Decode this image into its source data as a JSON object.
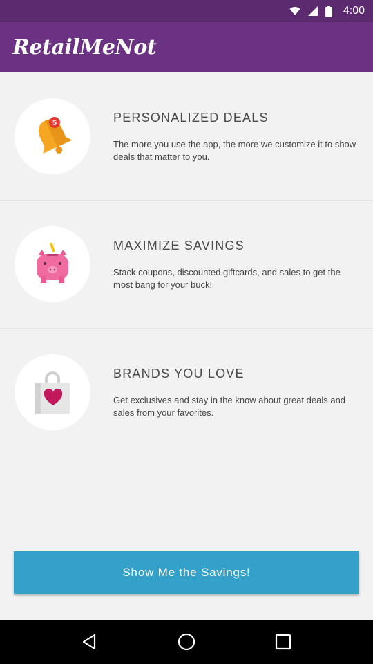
{
  "status_bar": {
    "time": "4:00",
    "icons": [
      "wifi-icon",
      "signal-icon",
      "battery-icon"
    ]
  },
  "app_bar": {
    "logo_text": "RetailMeNot"
  },
  "features": [
    {
      "icon": "bell-icon",
      "badge": "5",
      "title": "PERSONALIZED DEALS",
      "description": "The more you use the app, the more we customize it to show deals that matter to you."
    },
    {
      "icon": "piggy-bank-icon",
      "title": "MAXIMIZE SAVINGS",
      "description": "Stack coupons, discounted giftcards, and sales to get the most bang for your buck!"
    },
    {
      "icon": "shopping-bag-heart-icon",
      "title": "BRANDS YOU LOVE",
      "description": "Get exclusives and stay in the know about great deals and sales from your favorites."
    }
  ],
  "cta": {
    "label": "Show Me the Savings!"
  },
  "nav_bar": {
    "icons": [
      "back-icon",
      "home-icon",
      "recents-icon"
    ]
  },
  "colors": {
    "header": "#6b3182",
    "status_bar": "#5c2a6e",
    "cta": "#33a1c9",
    "bell": "#f5a623",
    "piggy": "#f06ba0",
    "heart": "#c2185b"
  }
}
